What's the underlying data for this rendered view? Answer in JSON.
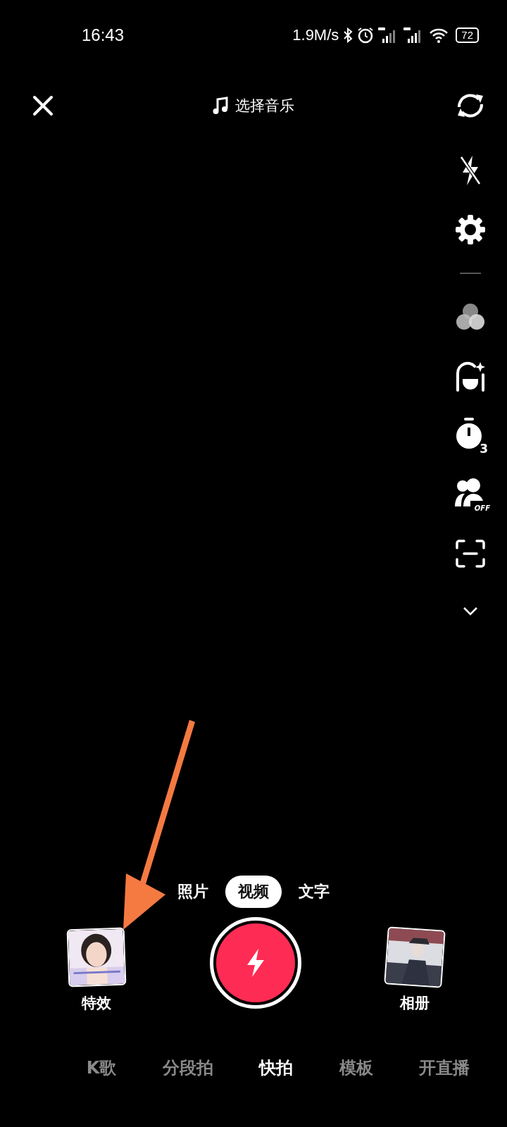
{
  "status_bar": {
    "time": "16:43",
    "net_speed": "1.9M/s",
    "battery": "72"
  },
  "top_bar": {
    "music_label": "选择音乐"
  },
  "side_tools": [
    {
      "kind": "flip"
    },
    {
      "kind": "flash"
    },
    {
      "kind": "settings"
    },
    {
      "kind": "divider"
    },
    {
      "kind": "filter"
    },
    {
      "kind": "beauty"
    },
    {
      "kind": "timer",
      "badge": "3"
    },
    {
      "kind": "people",
      "badge": "OFF"
    },
    {
      "kind": "scan"
    },
    {
      "kind": "more"
    }
  ],
  "mode_tabs": [
    {
      "label": "照片",
      "selected": false
    },
    {
      "label": "视频",
      "selected": true
    },
    {
      "label": "文字",
      "selected": false
    }
  ],
  "effects": {
    "label": "特效",
    "kind": "picture"
  },
  "album": {
    "label": "相册",
    "kind": "picture"
  },
  "bottom_tabs": [
    {
      "label": "K歌",
      "selected": false
    },
    {
      "label": "分段拍",
      "selected": false
    },
    {
      "label": "快拍",
      "selected": true
    },
    {
      "label": "模板",
      "selected": false
    },
    {
      "label": "开直播",
      "selected": false
    }
  ],
  "annotation": {
    "kind": "arrow",
    "color": "#f47a42"
  }
}
